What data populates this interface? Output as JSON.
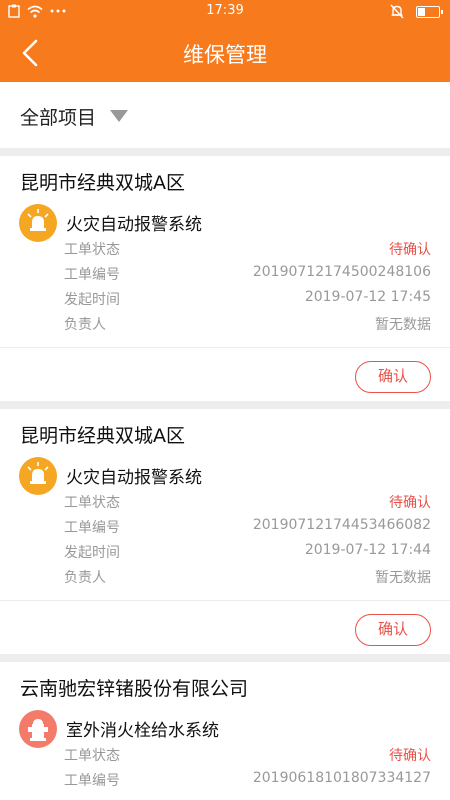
{
  "statusbar": {
    "time": "17:39",
    "left_icons": [
      "clipboard-icon",
      "wifi-icon",
      "more-dots-icon"
    ],
    "right_icons": [
      "bell-off-icon",
      "battery-icon"
    ],
    "battery_level": 0.35
  },
  "header": {
    "title": "维保管理"
  },
  "filter": {
    "label": "全部项目"
  },
  "labels": {
    "status": "工单状态",
    "number": "工单编号",
    "time": "发起时间",
    "owner": "负责人"
  },
  "orders": [
    {
      "project": "昆明市经典双城A区",
      "system": "火灾自动报警系统",
      "icon": "alarm-light-icon",
      "status": "待确认",
      "number": "20190712174500248106",
      "time": "2019-07-12 17:45",
      "owner": "暂无数据",
      "button": "确认"
    },
    {
      "project": "昆明市经典双城A区",
      "system": "火灾自动报警系统",
      "icon": "alarm-light-icon",
      "status": "待确认",
      "number": "20190712174453466082",
      "time": "2019-07-12 17:44",
      "owner": "暂无数据",
      "button": "确认"
    },
    {
      "project": "云南驰宏锌锗股份有限公司",
      "system": "室外消火栓给水系统",
      "icon": "hydrant-icon",
      "status": "待确认",
      "number": "20190618101807334127"
    }
  ],
  "colors": {
    "primary": "#f77a1c",
    "status": "#e8534a",
    "fire_icon_bg": "#f5a623",
    "hydrant_icon_bg": "#f47a6a"
  }
}
